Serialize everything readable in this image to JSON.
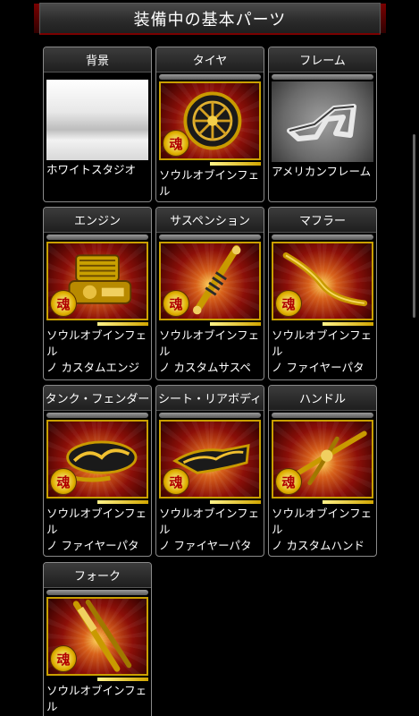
{
  "header": {
    "title": "装備中の基本パーツ"
  },
  "badge_text": "魂",
  "parts": [
    {
      "category": "背景",
      "item": "ホワイトスタジオ",
      "icon": "white-studio-icon"
    },
    {
      "category": "タイヤ",
      "item": "ソウルオブインフェル\nノ カスタムホイール",
      "icon": "wheel-icon"
    },
    {
      "category": "フレーム",
      "item": "アメリカンフレーム",
      "icon": "frame-icon"
    },
    {
      "category": "エンジン",
      "item": "ソウルオブインフェル\nノ カスタムエンジン",
      "icon": "engine-icon"
    },
    {
      "category": "サスペンション",
      "item": "ソウルオブインフェル\nノ カスタムサスペン\nション",
      "icon": "suspension-icon"
    },
    {
      "category": "マフラー",
      "item": "ソウルオブインフェル\nノ ファイヤーパターン\nマフラー",
      "icon": "muffler-icon"
    },
    {
      "category": "タンク・フェンダー",
      "item": "ソウルオブインフェル\nノ ファイヤーパターン\nタンクA",
      "icon": "tank-icon"
    },
    {
      "category": "シート・リアボディ",
      "item": "ソウルオブインフェル\nノ ファイヤーパターン\nシートA",
      "icon": "seat-icon"
    },
    {
      "category": "ハンドル",
      "item": "ソウルオブインフェル\nノ カスタムハンドル",
      "icon": "handle-icon"
    },
    {
      "category": "フォーク",
      "item": "ソウルオブインフェル\nノ カスタムフォーク",
      "icon": "fork-icon"
    }
  ]
}
